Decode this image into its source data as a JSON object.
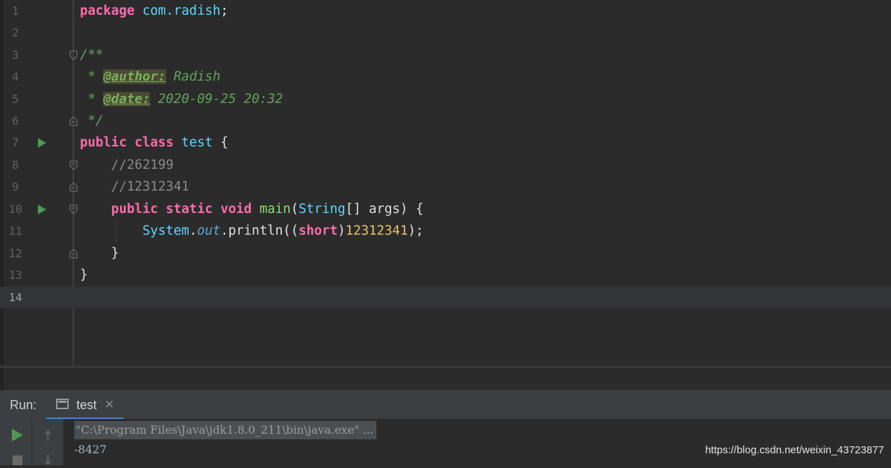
{
  "editor": {
    "line_numbers": [
      "1",
      "2",
      "3",
      "4",
      "5",
      "6",
      "7",
      "8",
      "9",
      "10",
      "11",
      "12",
      "13",
      "14"
    ],
    "current_line": "14",
    "code": {
      "l1_kw": "package",
      "l1_pkg": "com.radish",
      "l1_semi": ";",
      "l3": "/**",
      "l4_star": " * ",
      "l4_tag": "@author:",
      "l4_val": " Radish",
      "l5_star": " * ",
      "l5_tag": "@date:",
      "l5_val": " 2020-09-25 20:32",
      "l6": " */",
      "l7_kw": "public class ",
      "l7_name": "test",
      "l7_brace": " {",
      "l8": "    //262199",
      "l9": "    //12312341",
      "l10_kw": "    public static void ",
      "l10_fn": "main",
      "l10_p1": "(",
      "l10_cls": "String",
      "l10_rest": "[] args) {",
      "l11_cls": "        System",
      "l11_dot": ".",
      "l11_field": "out",
      "l11_call": ".println((",
      "l11_kw": "short",
      "l11_p": ")",
      "l11_num": "12312341",
      "l11_end": ");",
      "l12": "    }",
      "l13": "}"
    }
  },
  "run_panel": {
    "label": "Run:",
    "tab_label": "test",
    "tab_close": "✕",
    "output_cmd": "\"C:\\Program Files\\Java\\jdk1.8.0_211\\bin\\java.exe\" ...",
    "output_value": "-8427",
    "up_arrow": "↑",
    "down_arrow": "↓"
  },
  "watermark": "https://blog.csdn.net/weixin_43723877",
  "colors": {
    "keyword": "#ff6bac",
    "class": "#5fd7ff",
    "comment": "#62a35c",
    "number": "#e7c26b",
    "run_green": "#4e9a51"
  }
}
